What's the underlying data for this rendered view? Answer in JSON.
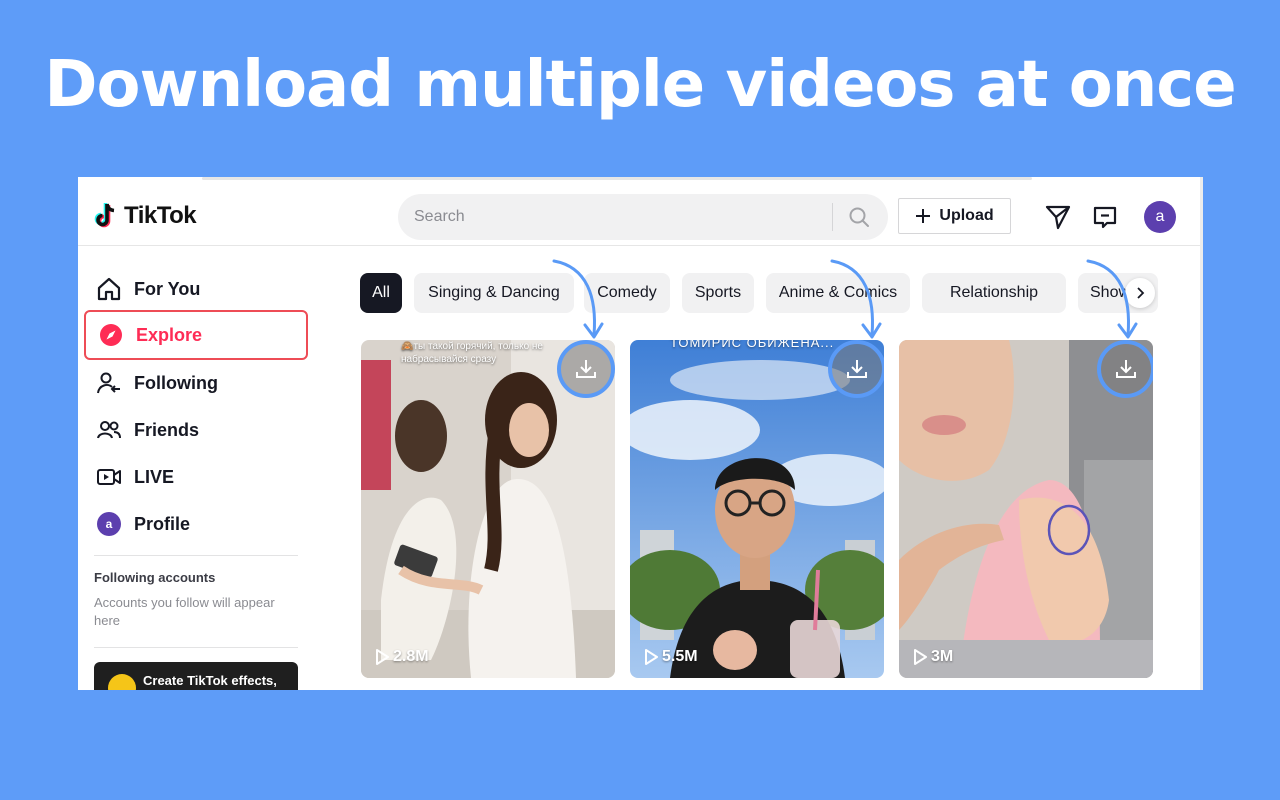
{
  "headline": "Download multiple videos at once",
  "colors": {
    "background": "#5e9cf8",
    "accent": "#fe2c55",
    "highlight": "#5a9af6"
  },
  "topbar": {
    "logo_text": "TikTok",
    "search_placeholder": "Search",
    "upload_label": "Upload",
    "icons": [
      "send-icon",
      "inbox-icon",
      "search-icon",
      "plus-icon"
    ],
    "avatar_letter": "a"
  },
  "sidebar": {
    "items": [
      {
        "label": "For You",
        "icon": "home-icon"
      },
      {
        "label": "Explore",
        "icon": "compass-icon"
      },
      {
        "label": "Following",
        "icon": "following-icon"
      },
      {
        "label": "Friends",
        "icon": "friends-icon"
      },
      {
        "label": "LIVE",
        "icon": "live-icon"
      },
      {
        "label": "Profile",
        "icon": "avatar"
      }
    ],
    "profile_avatar_letter": "a",
    "following_title": "Following accounts",
    "following_note": "Accounts you follow will appear here",
    "effects_label": "Create TikTok effects,"
  },
  "chips": [
    "All",
    "Singing & Dancing",
    "Comedy",
    "Sports",
    "Anime & Comics",
    "Relationship",
    "Shows"
  ],
  "videos": [
    {
      "views": "2.8M",
      "overlay": "🙈ты такой горячий, только не набрасывайся сразу"
    },
    {
      "views": "5.5M",
      "overlay": "ТОМИРИС ОБИЖЕНА..."
    },
    {
      "views": "3M",
      "overlay": ""
    }
  ]
}
